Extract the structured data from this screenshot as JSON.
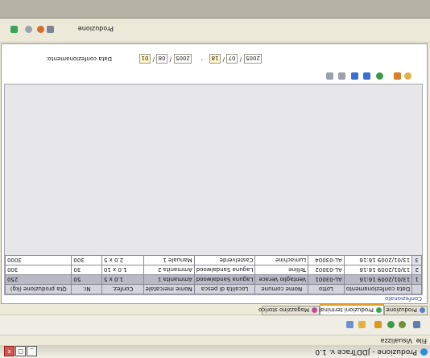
{
  "window": {
    "title": "Produzione - JDDTrace v. 1.0",
    "minimize": "_",
    "maximize": "□",
    "close": "x"
  },
  "menu": {
    "items": [
      "File",
      "Visualizza"
    ]
  },
  "tabs": [
    {
      "label": "Produzione",
      "active": false
    },
    {
      "label": "Produzioni terminate",
      "active": true
    },
    {
      "label": "Magazzino storico",
      "active": false
    }
  ],
  "panel": {
    "group_label": "Confezionato"
  },
  "table": {
    "columns": [
      "",
      "Data confezionamento",
      "Lotto",
      "Nome comune",
      "Località di pesca",
      "Nome mercatale",
      "Confez.",
      "Nr.",
      "Qta produzione (kg)"
    ],
    "rows": [
      {
        "n": "1",
        "date": "13/01/2009 16:16",
        "lotto": "AL-03001",
        "nome": "Ventaglio Verace",
        "loc": "Laguna Sandalwood",
        "merc": "Ammanita 1",
        "conf": "1.0 x 5",
        "nr": "50",
        "qta": "250",
        "selected": true
      },
      {
        "n": "2",
        "date": "13/01/2009 16:16",
        "lotto": "AL-03002",
        "nome": "Telline",
        "loc": "Laguna Sandalwood",
        "merc": "Ammanita 2",
        "conf": "1.0 x 10",
        "nr": "30",
        "qta": "300",
        "selected": false
      },
      {
        "n": "3",
        "date": "13/01/2009 16:16",
        "lotto": "AL-03004",
        "nome": "Lumachine",
        "loc": "Castelverde",
        "merc": "Manuale 1",
        "conf": "2.0 x 5",
        "nr": "300",
        "qta": "3000",
        "selected": false
      }
    ]
  },
  "dates": {
    "label": "Data confezionamento:",
    "from": {
      "day": "01",
      "month": "08",
      "year": "2005"
    },
    "to": {
      "day": "18",
      "month": "07",
      "year": "2005"
    },
    "sep": "/",
    "range_sep": "-"
  },
  "bottom": {
    "label": "Produzione"
  }
}
